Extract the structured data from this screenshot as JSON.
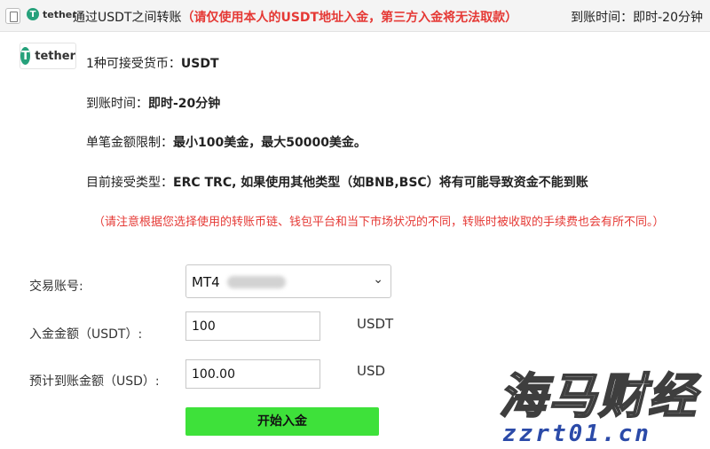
{
  "header": {
    "brand": "tether",
    "title": "通过USDT之间转账",
    "warning": "（请仅使用本人的USDT地址入金，第三方入金将无法取款）",
    "arrival_label": "到账时间：",
    "arrival_value": "即时-20分钟"
  },
  "brand_logo": {
    "symbol": "T",
    "text": "tether"
  },
  "info": {
    "currency_label": "1种可接受货币：",
    "currency_value": "USDT",
    "time_label": "到账时间：",
    "time_value": "即时-20分钟",
    "limit_label": "单笔金额限制：",
    "limit_value": "最小100美金，最大50000美金。",
    "type_label": "目前接受类型：",
    "type_value": "ERC TRC, 如果使用其他类型（如BNB,BSC）将有可能导致资金不能到账",
    "note": "（请注意根据您选择使用的转账币链、钱包平台和当下市场状况的不同，转账时被收取的手续费也会有所不同。）"
  },
  "form": {
    "account_label": "交易账号:",
    "account_value": "MT4",
    "amount_label": "入金金额（USDT）:",
    "amount_value": "100",
    "amount_unit": "USDT",
    "estimate_label": "预计到账金额（USD）:",
    "estimate_value": "100.00",
    "estimate_unit": "USD",
    "submit_label": "开始入金"
  },
  "watermark": {
    "text": "海马财经",
    "url": "zzrt01.cn"
  },
  "colors": {
    "warning": "#e53935",
    "accent_button": "#3ee13a",
    "tether_green": "#26a17b"
  }
}
